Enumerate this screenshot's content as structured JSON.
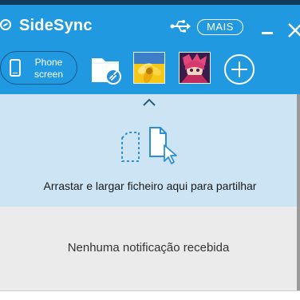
{
  "app": {
    "title": "SideSync",
    "more_label": "MAIS"
  },
  "toolbar": {
    "phone_screen_label": "Phone\nscreen"
  },
  "drop_zone": {
    "text": "Arrastar e largar ficheiro aqui para partilhar"
  },
  "notifications": {
    "empty_text": "Nenhuma notificação recebida"
  },
  "icons": {
    "app_logo": "sidesync-logo-icon",
    "usb": "usb-icon",
    "minimize": "minimize-icon",
    "close": "close-icon",
    "phone": "phone-icon",
    "folder": "folder-icon",
    "add": "plus-icon",
    "collapse": "chevron-up-icon",
    "drop": "file-drop-icon"
  },
  "colors": {
    "accent": "#2199e0",
    "drop_zone_bg": "#cce4f3",
    "notif_bg": "#ebebeb",
    "icon_blue": "#2b8fd6"
  }
}
